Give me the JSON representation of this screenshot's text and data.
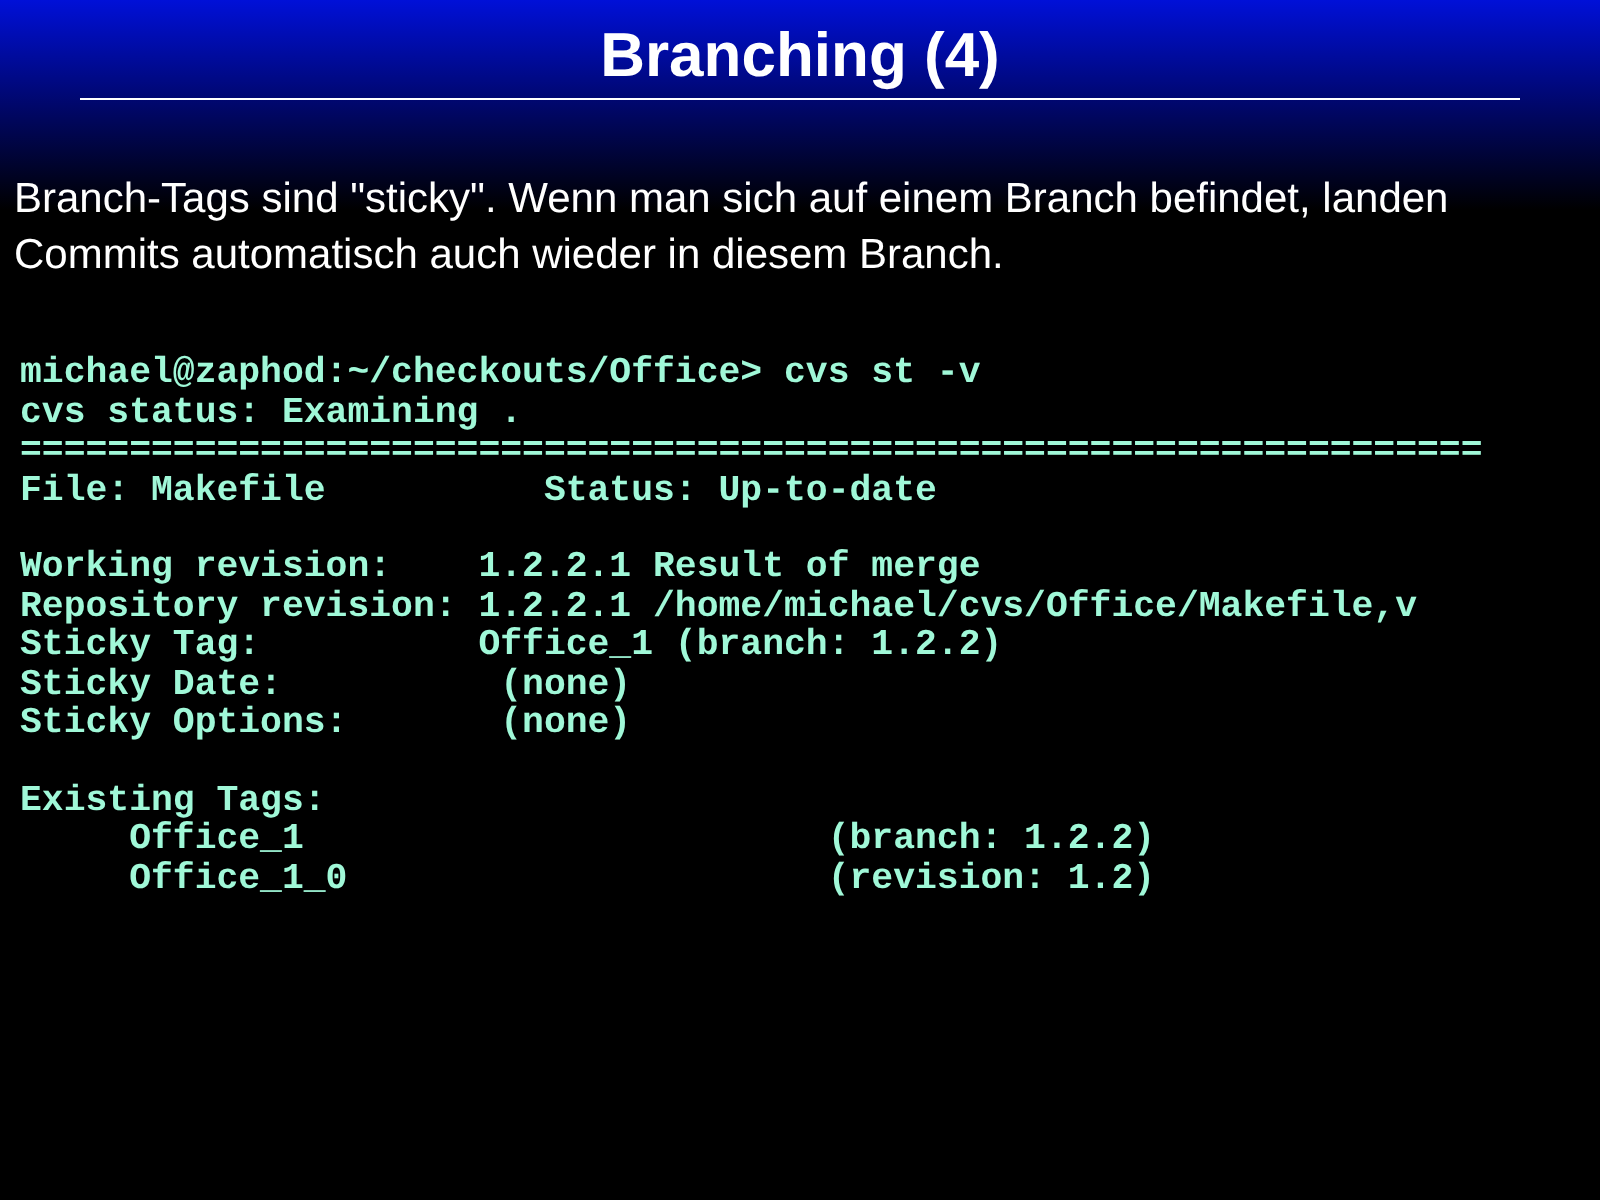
{
  "slide": {
    "title": "Branching (4)",
    "intro": [
      "Branch-Tags sind \"sticky\". Wenn man sich auf einem Branch befindet, landen",
      "Commits automatisch auch wieder in diesem Branch."
    ],
    "terminal": [
      [
        "michael@zaphod:~/checkouts/Office> cvs st -v",
        "cvs status: Examining .",
        "===================================================================",
        "File: Makefile          Status: Up-to-date"
      ],
      [
        "Working revision:    1.2.2.1 Result of merge",
        "Repository revision: 1.2.2.1 /home/michael/cvs/Office/Makefile,v",
        "Sticky Tag:          Office_1 (branch: 1.2.2)",
        "Sticky Date:          (none)",
        "Sticky Options:       (none)"
      ],
      [
        "Existing Tags:",
        "     Office_1                        (branch: 1.2.2)",
        "     Office_1_0                      (revision: 1.2)"
      ]
    ]
  }
}
